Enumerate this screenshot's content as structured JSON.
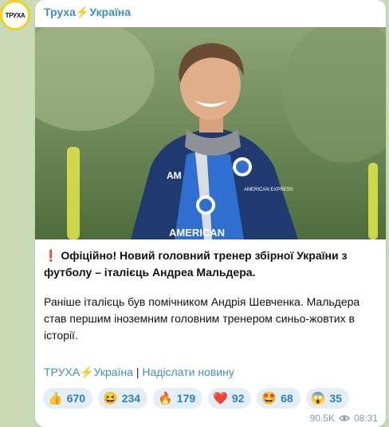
{
  "channel": {
    "avatar_text": "ТРУХА",
    "name": "Труха⚡Україна"
  },
  "post": {
    "headline_mark": "❗",
    "headline": "Офіційно! Новий головний тренер збірної України з футболу – італієць Андреа Мальдера.",
    "body": "Раніше італієць був помічником Андрія Шевченка. Мальдера став першим іноземним головним тренером синьо-жовтих в історії.",
    "link_channel": "ТРУХА⚡Україна",
    "link_separator": " | ",
    "link_submit": "Надіслати новину",
    "shirt_text_top": "AM",
    "shirt_text_bottom": "AMERICAN",
    "badge_text": "AMERICAN EXPRESS"
  },
  "reactions": [
    {
      "icon": "thumbs-up-icon",
      "emoji": "👍",
      "count": "670"
    },
    {
      "icon": "smile-face-icon",
      "emoji": "😆",
      "count": "234"
    },
    {
      "icon": "fire-icon",
      "emoji": "🔥",
      "count": "179"
    },
    {
      "icon": "heart-icon",
      "emoji": "❤️",
      "count": "92"
    },
    {
      "icon": "party-face-icon",
      "emoji": "🤩",
      "count": "68"
    },
    {
      "icon": "screaming-face-icon",
      "emoji": "😱",
      "count": "35"
    }
  ],
  "meta": {
    "views": "90.5K",
    "time": "08:31"
  },
  "colors": {
    "accent": "#3d8fc8",
    "reaction_bg": "#e4eef7",
    "chat_bg": "#c9dbb6",
    "avatar_ring": "#f2d21b"
  }
}
